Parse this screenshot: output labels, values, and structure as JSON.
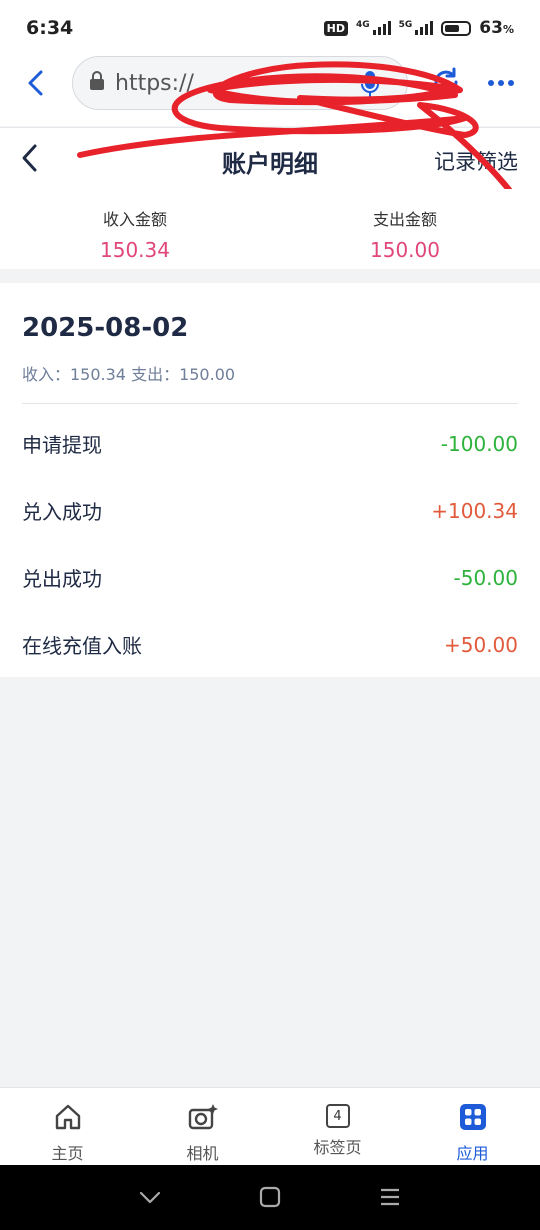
{
  "status_bar": {
    "time": "6:34",
    "hd": "HD",
    "net1": "4G",
    "net2": "5G",
    "battery_pct": "63",
    "battery_unit": "%"
  },
  "browser": {
    "url": "https://",
    "icons": [
      "back-arrow-icon",
      "lock-icon",
      "mic-icon",
      "refresh-icon",
      "more-icon"
    ],
    "accent_color": "#1e5bd8"
  },
  "header": {
    "title": "账户明细",
    "filter_label": "记录筛选"
  },
  "summary": {
    "income_label": "收入金额",
    "income_value": "150.34",
    "expense_label": "支出金额",
    "expense_value": "150.00",
    "value_color": "#e0457b"
  },
  "day": {
    "date": "2025-08-02",
    "summary_text": "收入：150.34 支出：150.00",
    "records": [
      {
        "label": "申请提现",
        "amount": "-100.00",
        "sign": "negative"
      },
      {
        "label": "兑入成功",
        "amount": "+100.34",
        "sign": "positive"
      },
      {
        "label": "兑出成功",
        "amount": "-50.00",
        "sign": "negative"
      },
      {
        "label": "在线充值入账",
        "amount": "+50.00",
        "sign": "positive"
      }
    ]
  },
  "bottom_nav": {
    "items": [
      {
        "label": "主页",
        "icon": "home-icon"
      },
      {
        "label": "相机",
        "icon": "camera-icon"
      },
      {
        "label": "标签页",
        "icon": "tabs-icon",
        "count": "4"
      },
      {
        "label": "应用",
        "icon": "apps-icon",
        "active": true
      }
    ]
  }
}
